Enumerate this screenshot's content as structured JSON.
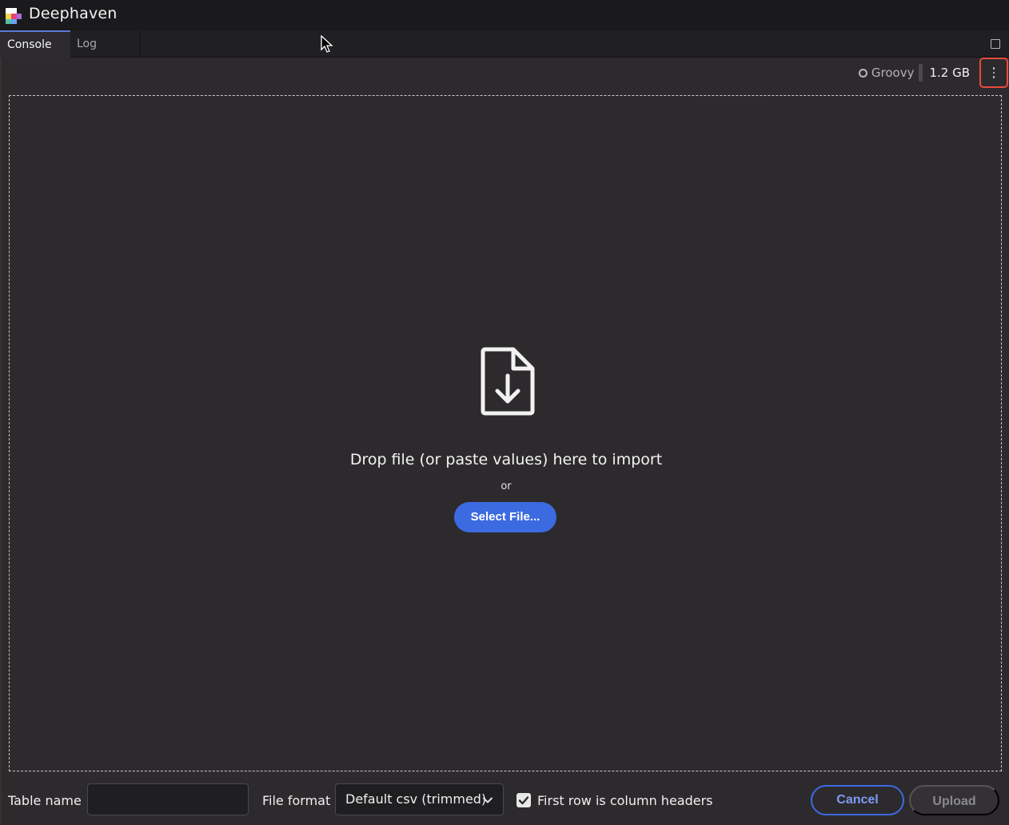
{
  "app": {
    "title": "Deephaven"
  },
  "tabs": [
    {
      "label": "Console",
      "active": true
    },
    {
      "label": "Log",
      "active": false
    }
  ],
  "status": {
    "language": "Groovy",
    "memory": "1.2 GB"
  },
  "dropzone": {
    "message": "Drop file (or paste values) here to import",
    "or_text": "or",
    "select_button": "Select File..."
  },
  "footer": {
    "table_name_label": "Table name",
    "table_name_value": "",
    "file_format_label": "File format",
    "file_format_value": "Default csv (trimmed)",
    "first_row_headers_label": "First row is column headers",
    "first_row_headers_checked": true,
    "cancel_label": "Cancel",
    "upload_label": "Upload"
  },
  "colors": {
    "accent": "#3c6ae0",
    "highlight": "#ea4b3c",
    "background": "#2d2a2e"
  }
}
